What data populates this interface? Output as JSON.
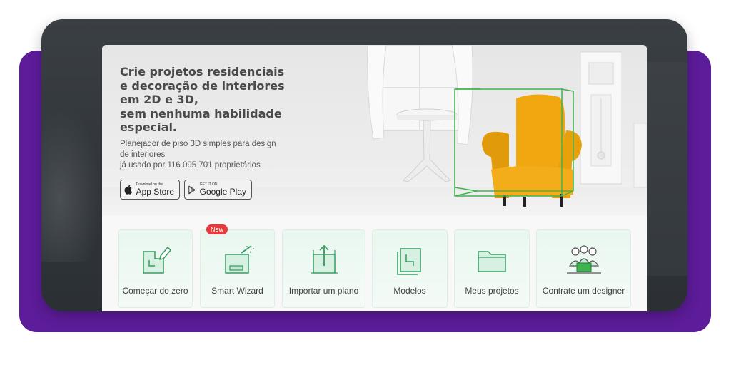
{
  "hero": {
    "headline_lines": [
      "Crie projetos residenciais",
      "e decoração de interiores",
      "em 2D e 3D,",
      "sem nenhuma habilidade",
      "especial."
    ],
    "subline_lines": [
      "Planejador de piso 3D simples para design",
      "de interiores",
      "já usado por 116 095 701 proprietários"
    ]
  },
  "stores": {
    "apple_small": "Download on the",
    "apple_big": "App Store",
    "google_small": "GET IT ON",
    "google_big": "Google Play"
  },
  "cards": [
    {
      "label": "Começar do zero",
      "icon": "floor-plan-pencil-icon"
    },
    {
      "label": "Smart Wizard",
      "icon": "magic-wand-room-icon",
      "badge": "New"
    },
    {
      "label": "Importar um plano",
      "icon": "import-plan-icon"
    },
    {
      "label": "Modelos",
      "icon": "templates-plan-icon"
    },
    {
      "label": "Meus projetos",
      "icon": "folder-icon"
    },
    {
      "label": "Contrate um designer",
      "icon": "designers-group-icon"
    }
  ],
  "colors": {
    "frame_purple": "#5d1c9a",
    "frame_dark": "#33383c",
    "chair_yellow": "#f1a810",
    "selection_green": "#3fb34f",
    "card_green": "#e9f7ef",
    "badge_red": "#e83a3a"
  }
}
